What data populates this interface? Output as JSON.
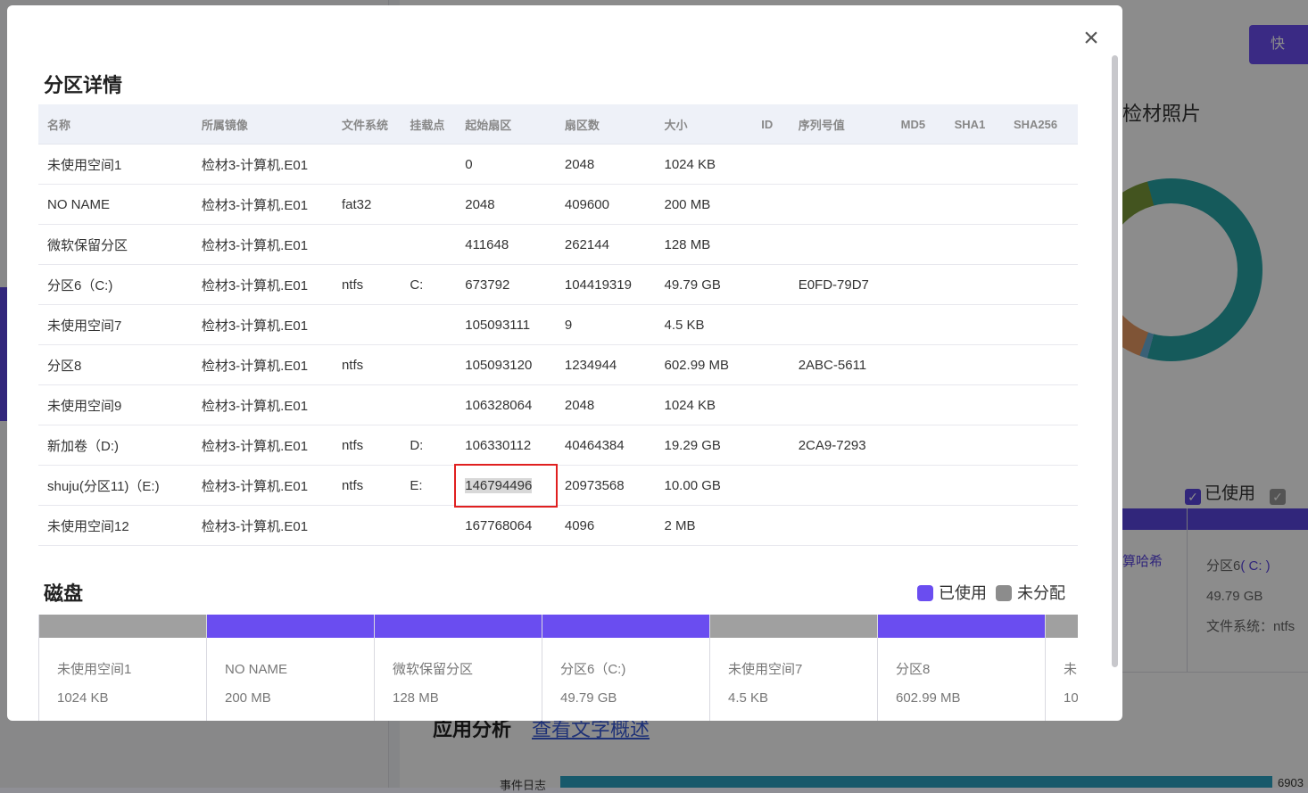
{
  "background": {
    "quick_button": "快",
    "photo_title": "检材照片",
    "legend_used": "已使用",
    "hash_link": "算哈希",
    "partition_label": "分区6",
    "partition_letter": "( C: )",
    "partition_size": "49.79 GB",
    "partition_fs": "文件系统：ntfs",
    "app_title": "应用分析",
    "app_link": "查看文字概述",
    "event_label": "事件日志",
    "event_value": "6903"
  },
  "modal": {
    "close_glyph": "×",
    "title": "分区详情",
    "columns": [
      "名称",
      "所属镜像",
      "文件系统",
      "挂载点",
      "起始扇区",
      "扇区数",
      "大小",
      "ID",
      "序列号值",
      "MD5",
      "SHA1",
      "SHA256"
    ],
    "rows": [
      [
        "未使用空间1",
        "检材3-计算机.E01",
        "",
        "",
        "0",
        "2048",
        "1024 KB",
        "",
        "",
        "",
        "",
        ""
      ],
      [
        "NO NAME",
        "检材3-计算机.E01",
        "fat32",
        "",
        "2048",
        "409600",
        "200 MB",
        "",
        "",
        "",
        "",
        ""
      ],
      [
        "微软保留分区",
        "检材3-计算机.E01",
        "",
        "",
        "411648",
        "262144",
        "128 MB",
        "",
        "",
        "",
        "",
        ""
      ],
      [
        "分区6（C:)",
        "检材3-计算机.E01",
        "ntfs",
        "C:",
        "673792",
        "104419319",
        "49.79 GB",
        "",
        "E0FD-79D7",
        "",
        "",
        ""
      ],
      [
        "未使用空间7",
        "检材3-计算机.E01",
        "",
        "",
        "105093111",
        "9",
        "4.5 KB",
        "",
        "",
        "",
        "",
        ""
      ],
      [
        "分区8",
        "检材3-计算机.E01",
        "ntfs",
        "",
        "105093120",
        "1234944",
        "602.99 MB",
        "",
        "2ABC-5611",
        "",
        "",
        ""
      ],
      [
        "未使用空间9",
        "检材3-计算机.E01",
        "",
        "",
        "106328064",
        "2048",
        "1024 KB",
        "",
        "",
        "",
        "",
        ""
      ],
      [
        "新加卷（D:)",
        "检材3-计算机.E01",
        "ntfs",
        "D:",
        "106330112",
        "40464384",
        "19.29 GB",
        "",
        "2CA9-7293",
        "",
        "",
        ""
      ],
      [
        "shuju(分区11)（E:)",
        "检材3-计算机.E01",
        "ntfs",
        "E:",
        "146794496",
        "20973568",
        "10.00 GB",
        "",
        "",
        "",
        "",
        ""
      ],
      [
        "未使用空间12",
        "检材3-计算机.E01",
        "",
        "",
        "167768064",
        "4096",
        "2 MB",
        "",
        "",
        "",
        "",
        ""
      ]
    ],
    "highlighted_cell": {
      "row": 8,
      "col": 4
    },
    "disk_title": "磁盘",
    "legend": {
      "used": "已使用",
      "unallocated": "未分配"
    },
    "disk_segments": [
      {
        "name": "未使用空间1",
        "size": "1024 KB",
        "state": "free"
      },
      {
        "name": "NO NAME",
        "size": "200 MB",
        "state": "used"
      },
      {
        "name": "微软保留分区",
        "size": "128 MB",
        "state": "used"
      },
      {
        "name": "分区6（C:)",
        "size": "49.79 GB",
        "state": "used"
      },
      {
        "name": "未使用空间7",
        "size": "4.5 KB",
        "state": "free"
      },
      {
        "name": "分区8",
        "size": "602.99 MB",
        "state": "used"
      },
      {
        "name": "未",
        "size": "10",
        "state": "free"
      }
    ],
    "colors": {
      "used": "#6a4df0",
      "free": "#a0a0a0",
      "highlight": "#e02020"
    }
  }
}
